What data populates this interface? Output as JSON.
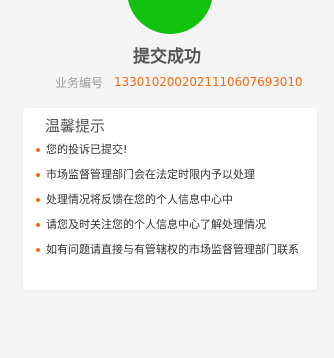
{
  "colors": {
    "success": "#11c20f",
    "accent": "#ef6c16",
    "background": "#f5f5f5"
  },
  "status_icon": "success-circle",
  "title": "提交成功",
  "business": {
    "label": "业务编号",
    "number": "1330102002021110607693010"
  },
  "notice": {
    "title": "温馨提示",
    "items": [
      "您的投诉已提交!",
      "市场监督管理部门会在法定时限内予以处理",
      "处理情况将反馈在您的个人信息中心中",
      "请您及时关注您的个人信息中心了解处理情况",
      "如有问题请直接与有管辖权的市场监督管理部门联系"
    ]
  }
}
